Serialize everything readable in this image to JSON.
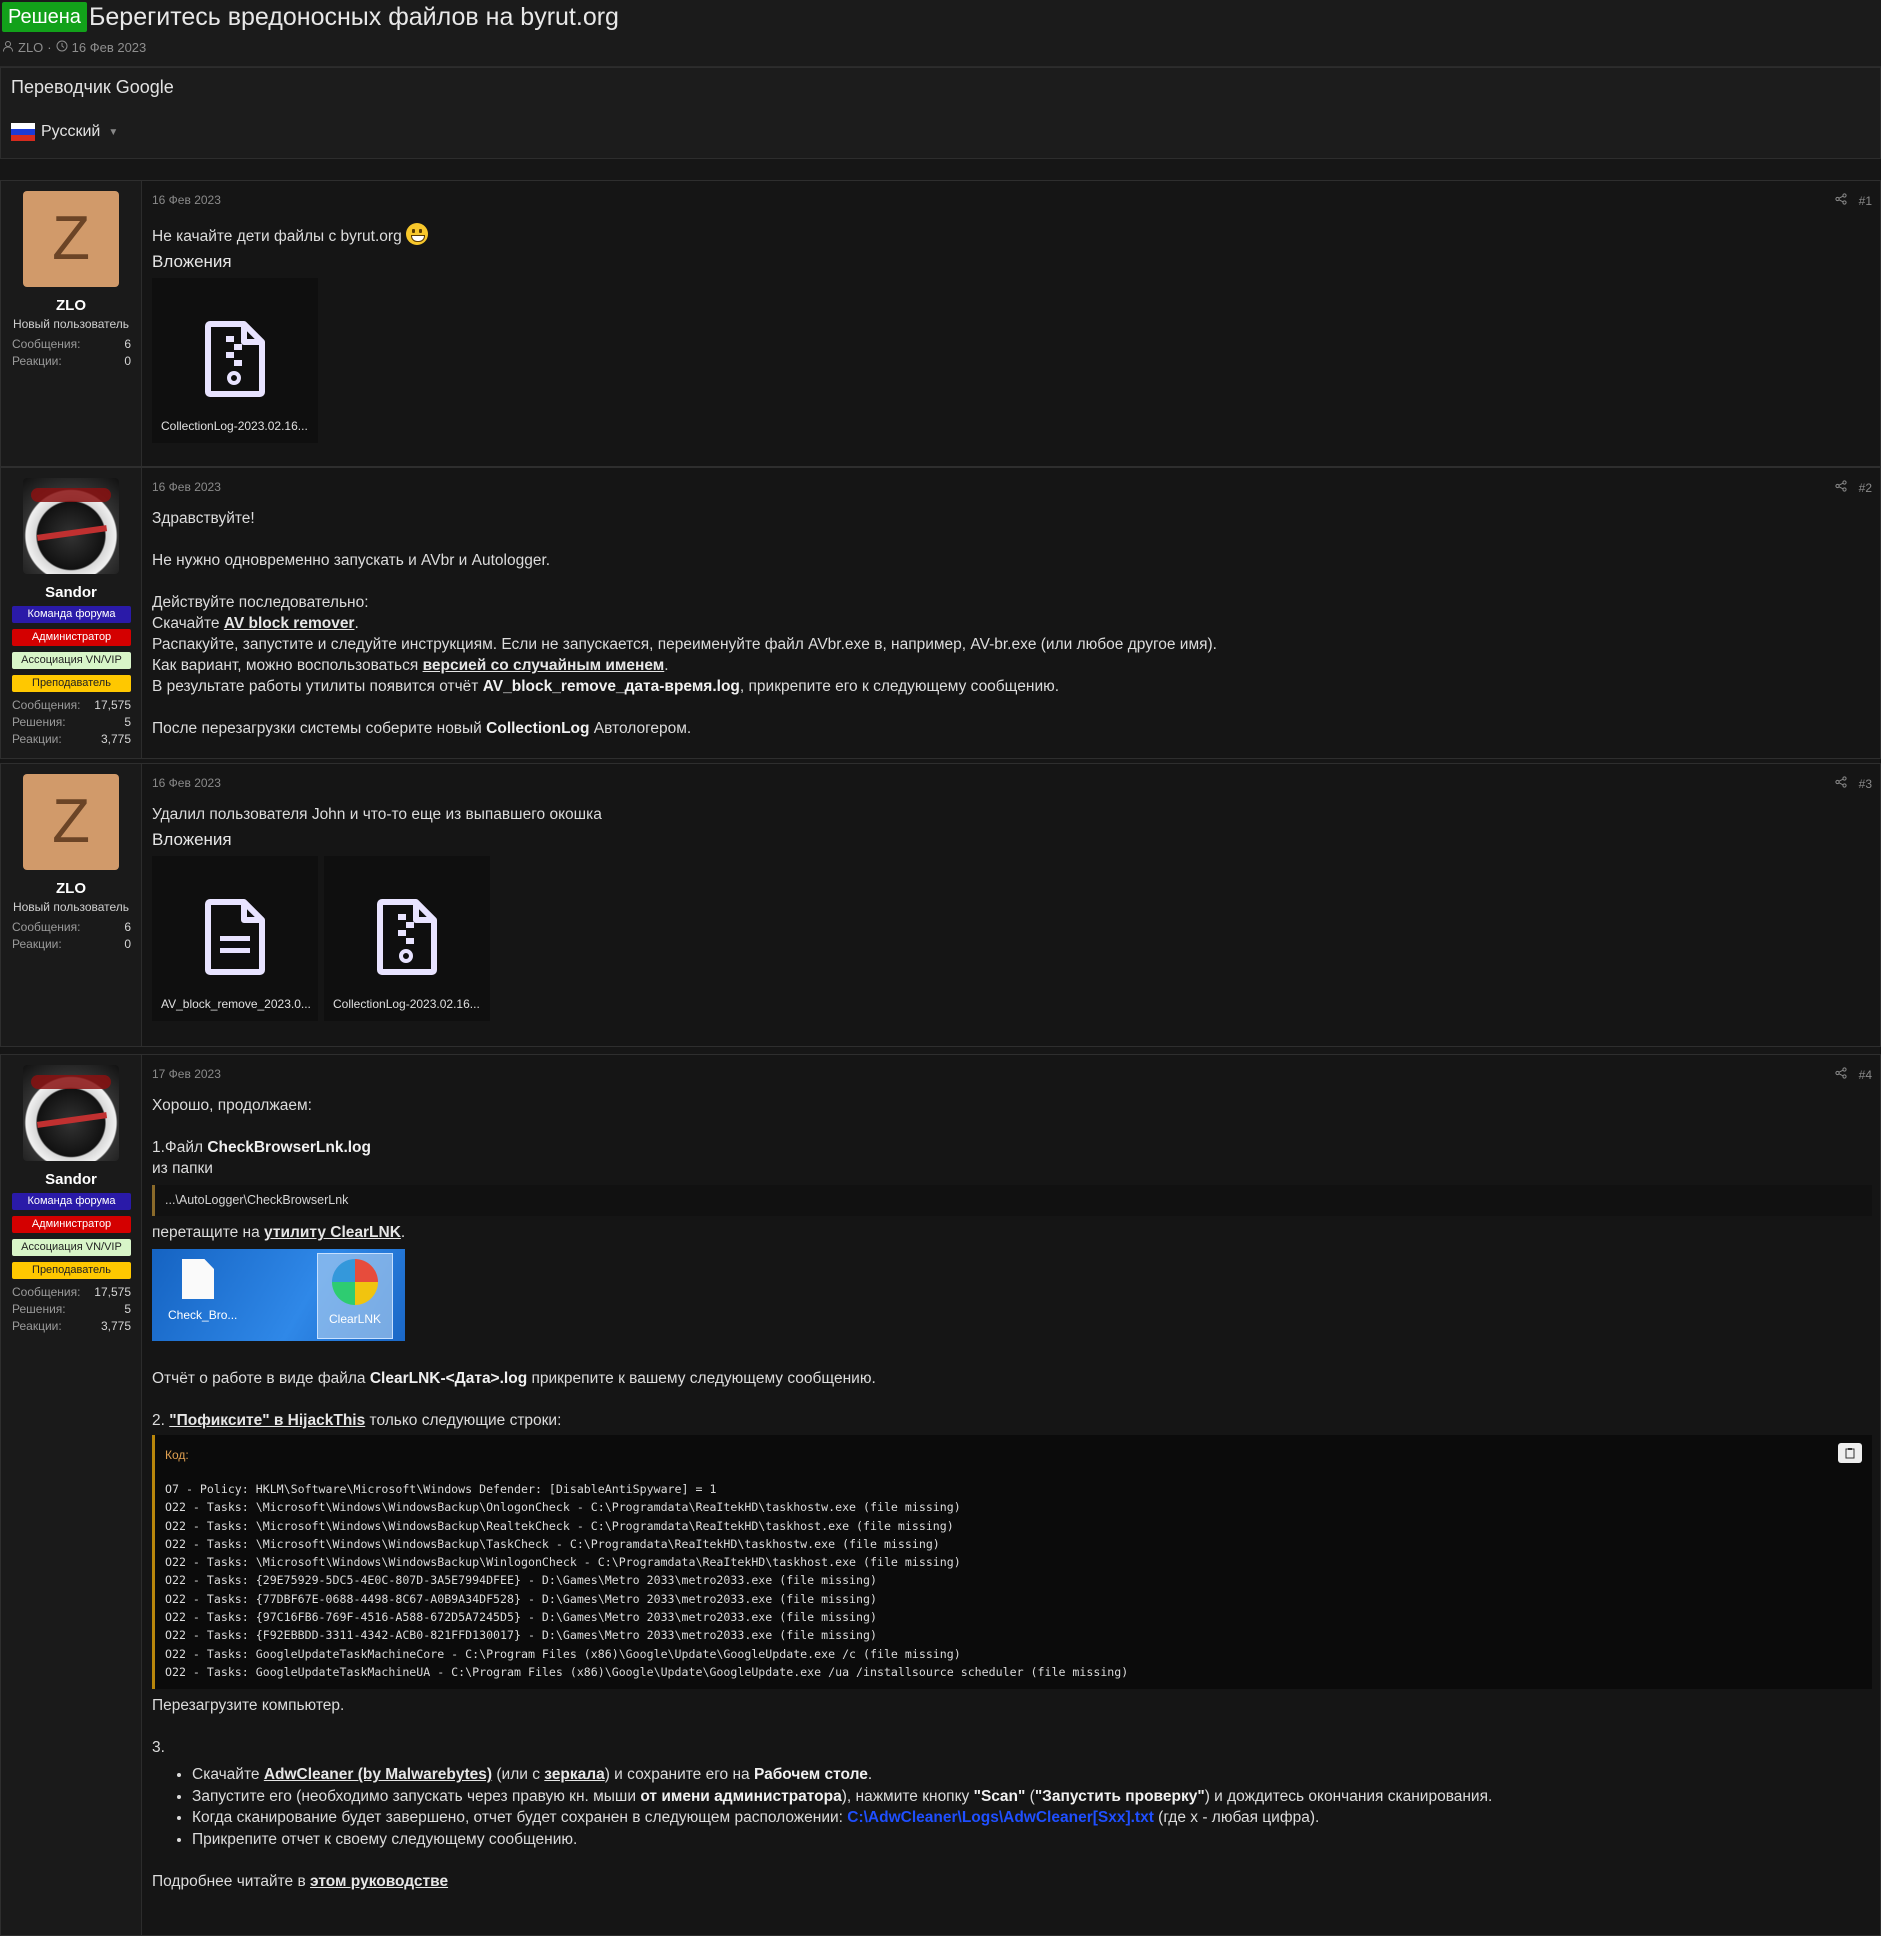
{
  "thread": {
    "solved_label": "Решена",
    "title": "Берегитесь вредоносных файлов на byrut.org",
    "author": "ZLO",
    "date": "16 Фев 2023"
  },
  "translator": {
    "title": "Переводчик Google",
    "language": "Русский"
  },
  "users": {
    "zlo": {
      "initial": "Z",
      "name": "ZLO",
      "title": "Новый пользователь",
      "stats": [
        {
          "label": "Сообщения:",
          "value": "6"
        },
        {
          "label": "Реакции:",
          "value": "0"
        }
      ]
    },
    "sandor": {
      "name": "Sandor",
      "banners": [
        "Команда форума",
        "Администратор",
        "Ассоциация VN/VIP",
        "Преподаватель"
      ],
      "stats": [
        {
          "label": "Сообщения:",
          "value": "17,575"
        },
        {
          "label": "Решения:",
          "value": "5"
        },
        {
          "label": "Реакции:",
          "value": "3,775"
        }
      ]
    }
  },
  "colors": {
    "solved": "#12a11a",
    "banner_team": "#2a1aa8",
    "banner_admin": "#d40000",
    "banner_vip": "#d8f5c8",
    "banner_teacher": "#ffc800"
  },
  "posts": [
    {
      "date": "16 Фев 2023",
      "number": "#1",
      "text": "Не качайте дети файлы с byrut.org",
      "attachments_header": "Вложения",
      "attachments": [
        {
          "name": "CollectionLog-2023.02.16...",
          "icon": "zip-file-icon"
        }
      ]
    },
    {
      "date": "16 Фев 2023",
      "number": "#2",
      "greeting": "Здравствуйте!",
      "line1": "Не нужно одновременно запускать и AVbr и Autologger.",
      "line2": "Действуйте последовательно:",
      "download_prefix": "Скачайте ",
      "download_link": "AV block remover",
      "line3": "Распакуйте, запустите и следуйте инструкциям. Если не запускается, переименуйте файл AVbr.exe в, например, AV-br.exe (или любое другое имя).",
      "variant_prefix": "Как вариант, можно воспользоваться ",
      "variant_link": "версией со случайным именем",
      "result_prefix": "В результате работы утилиты появится отчёт ",
      "result_bold": "AV_block_remove_дата-время.log",
      "result_suffix": ", прикрепите его к следующему сообщению.",
      "reboot_prefix": "После перезагрузки системы соберите новый ",
      "reboot_bold": "CollectionLog",
      "reboot_suffix": " Автологером."
    },
    {
      "date": "16 Фев 2023",
      "number": "#3",
      "text": "Удалил пользователя John и что-то еще из выпавшего окошка",
      "attachments_header": "Вложения",
      "attachments": [
        {
          "name": "AV_block_remove_2023.0...",
          "icon": "text-file-icon"
        },
        {
          "name": "CollectionLog-2023.02.16...",
          "icon": "zip-file-icon"
        }
      ]
    },
    {
      "date": "17 Фев 2023",
      "number": "#4",
      "intro": "Хорошо, продолжаем:",
      "step1_prefix": "1.Файл ",
      "step1_bold": "CheckBrowserLnk.log",
      "step1_folder": "из папки",
      "path": "...\\AutoLogger\\CheckBrowserLnk",
      "drag_prefix": "перетащите на ",
      "drag_link": "утилиту ClearLNK",
      "desktop_file": "Check_Bro...",
      "desktop_lnk": "ClearLNK",
      "report_prefix": "Отчёт о работе в виде файла ",
      "report_bold": "ClearLNK-<Дата>.log",
      "report_suffix": " прикрепите к вашему следующему сообщению.",
      "step2_prefix": "2. ",
      "step2_link": "\"Пофиксите\" в HijackThis",
      "step2_suffix": " только следующие строки:",
      "code_label": "Код:",
      "code_lines": [
        "O7 - Policy: HKLM\\Software\\Microsoft\\Windows Defender: [DisableAntiSpyware] = 1",
        "O22 - Tasks: \\Microsoft\\Windows\\WindowsBackup\\OnlogonCheck - C:\\Programdata\\ReaItekHD\\taskhostw.exe (file missing)",
        "O22 - Tasks: \\Microsoft\\Windows\\WindowsBackup\\RealtekCheck - C:\\Programdata\\ReaItekHD\\taskhost.exe (file missing)",
        "O22 - Tasks: \\Microsoft\\Windows\\WindowsBackup\\TaskCheck - C:\\Programdata\\ReaItekHD\\taskhostw.exe (file missing)",
        "O22 - Tasks: \\Microsoft\\Windows\\WindowsBackup\\WinlogonCheck - C:\\Programdata\\ReaItekHD\\taskhost.exe (file missing)",
        "O22 - Tasks: {29E75929-5DC5-4E0C-807D-3A5E7994DFEE} - D:\\Games\\Metro 2033\\metro2033.exe (file missing)",
        "O22 - Tasks: {77DBF67E-0688-4498-8C67-A0B9A34DF528} - D:\\Games\\Metro 2033\\metro2033.exe (file missing)",
        "O22 - Tasks: {97C16FB6-769F-4516-A588-672D5A7245D5} - D:\\Games\\Metro 2033\\metro2033.exe (file missing)",
        "O22 - Tasks: {F92EBBDD-3311-4342-ACB0-821FFD130017} - D:\\Games\\Metro 2033\\metro2033.exe (file missing)",
        "O22 - Tasks: GoogleUpdateTaskMachineCore - C:\\Program Files (x86)\\Google\\Update\\GoogleUpdate.exe /c (file missing)",
        "O22 - Tasks: GoogleUpdateTaskMachineUA - C:\\Program Files (x86)\\Google\\Update\\GoogleUpdate.exe /ua /installsource scheduler (file missing)"
      ],
      "reboot": "Перезагрузите компьютер.",
      "step3": "3.",
      "b1_prefix": "Скачайте ",
      "b1_link": "AdwCleaner (by Malwarebytes)",
      "b1_mid": " (или с ",
      "b1_link2": "зеркала",
      "b1_mid2": ") и сохраните его на ",
      "b1_bold": "Рабочем столе",
      "b1_end": ".",
      "b2_prefix": "Запустите его (необходимо запускать через правую кн. мыши ",
      "b2_bold": "от имени администратора",
      "b2_mid": "), нажмите кнопку ",
      "b2_bold2": "\"Scan\"",
      "b2_mid2": " (",
      "b2_bold3": "\"Запустить проверку\"",
      "b2_end": ") и дождитесь окончания сканирования.",
      "b3_prefix": "Когда сканирование будет завершено, отчет будет сохранен в следующем расположении: ",
      "b3_path": "C:\\AdwCleaner\\Logs\\AdwCleaner[Sxx].txt",
      "b3_end": " (где x - любая цифра).",
      "b4": "Прикрепите отчет к своему следующему сообщению.",
      "more_prefix": "Подробнее читайте в ",
      "more_link": "этом руководстве"
    }
  ]
}
